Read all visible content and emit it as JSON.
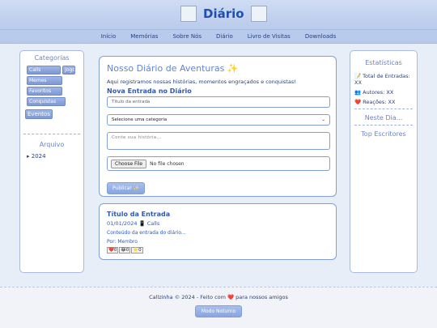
{
  "header": {
    "title": "Diário",
    "logo_left_icon": "broken-image-icon",
    "logo_right_icon": "broken-image-icon"
  },
  "nav": {
    "items": [
      "Início",
      "Memórias",
      "Sobre Nós",
      "Diário",
      "Livro de Visitas",
      "Downloads"
    ]
  },
  "sidebar_left": {
    "categories_title": "Categorias",
    "categories": [
      "Calls",
      "Jogos",
      "Memes",
      "Favoritos",
      "Conquistas",
      "Eventos"
    ],
    "archive_title": "Arquivo",
    "archive_items": [
      "▸ 2024"
    ]
  },
  "main": {
    "title": "Nosso Diário de Aventuras ✨",
    "subtitle": "Aqui registramos nossas histórias, momentos engraçados e conquistas!",
    "new_entry_heading": "Nova Entrada no Diário",
    "title_placeholder": "Título da entrada",
    "category_select_value": "Selecione uma categoria",
    "story_placeholder": "Conte sua história...",
    "file_button": "Choose File",
    "file_label": "No file chosen",
    "publish_button": "Publicar ✨"
  },
  "entry": {
    "title": "Título da Entrada",
    "meta": "01/01/2024 📱 Calls",
    "content": "Conteúdo da entrada do diário...",
    "author": "Por: Membro",
    "reactions": [
      "❤️0",
      "😂0",
      "⭐0"
    ]
  },
  "sidebar_right": {
    "stats_title": "Estatísticas",
    "total_entries": "📝 Total de Entradas: XX",
    "authors": "👥 Autores: XX",
    "reactions": "❤️ Reações: XX",
    "today_title": "Neste Dia...",
    "top_writers_title": "Top Escritores"
  },
  "footer": {
    "text": "Callzinha © 2024 - Feito com ❤️ para nossos amigos",
    "night_mode_button": "Modo Noturno"
  }
}
